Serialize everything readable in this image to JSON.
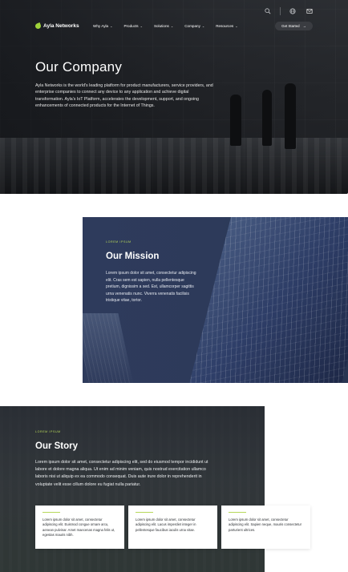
{
  "brand": {
    "name": "Ayla Networks",
    "accent": "#b7d85a"
  },
  "topbar": {
    "icons": [
      "search-icon",
      "globe-icon",
      "mail-icon"
    ]
  },
  "nav": {
    "items": [
      {
        "label": "Why Ayla"
      },
      {
        "label": "Products"
      },
      {
        "label": "Solutions"
      },
      {
        "label": "Company"
      },
      {
        "label": "Resources"
      }
    ],
    "cta_label": "Get Started"
  },
  "hero": {
    "title": "Our Company",
    "body": "Ayla Networks is the world's leading platform for product manufacturers, service providers, and enterprise companies to connect any device to any application and achieve digital transformation. Ayla's IoT Platform, accelerates the development, support, and ongoing enhancements of connected products for the Internet of Things."
  },
  "mission": {
    "eyebrow": "LOREM IPSUM",
    "title": "Our Mission",
    "body": "Lorem ipsum dolor sit amet, consectetur adipiscing elit. Cras sem est sapien, nulla pellentesque pretium, dignissim a sed. Est, ullamcorper sagittis urna venenatis nunc. Viverra venenatis facilisis tristique vitae, tortor."
  },
  "story": {
    "eyebrow": "LOREM IPSUM",
    "title": "Our Story",
    "body": "Lorem ipsum dolor sit amet, consectetur adipiscing elit, sed do eiusmod tempor incididunt ut labore et dolore magna aliqua. Ut enim ad minim veniam, quis nostrud exercitation ullamco laboris nisi ut aliquip ex ea commodo consequat. Duis aute irure dolor in reprehenderit in voluptate velit esse cillum dolore eu fugiat nulla pariatur.",
    "cards": [
      {
        "text": "Lorem ipsum dolor sit amet, consectetur adipiscing elit. Euismod congue ornare arcu, aenean pulvinar. Amet maecenas magna felis ut, egestas mauris nibh."
      },
      {
        "text": "Lorem ipsum dolor sit amet, consectetur adipiscing elit. Lacus imperdiet integer in pellentesque faucibus iaculis urna vitae."
      },
      {
        "text": "Lorem ipsum dolor sit amet, consectetur adipiscing elit. Sapien neque, mauris consectetur parturient ultrices."
      }
    ]
  }
}
